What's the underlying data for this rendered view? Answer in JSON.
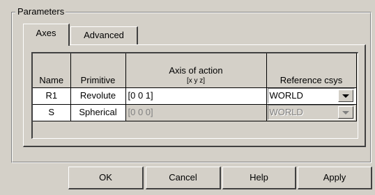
{
  "group": {
    "title": "Parameters"
  },
  "tabs": [
    {
      "label": "Axes",
      "active": true
    },
    {
      "label": "Advanced",
      "active": false
    }
  ],
  "table": {
    "headers": {
      "name": "Name",
      "primitive": "Primitive",
      "axis": "Axis of action",
      "axis_sub": "[x y z]",
      "reference": "Reference csys"
    },
    "rows": [
      {
        "name": "R1",
        "primitive": "Revolute",
        "axis": "[0 0 1]",
        "reference": "WORLD",
        "enabled": true
      },
      {
        "name": "S",
        "primitive": "Spherical",
        "axis": "[0 0 0]",
        "reference": "WORLD",
        "enabled": false
      }
    ]
  },
  "buttons": {
    "ok": "OK",
    "cancel": "Cancel",
    "help": "Help",
    "apply": "Apply"
  },
  "icons": {
    "dropdown": "chevron-down-icon"
  }
}
